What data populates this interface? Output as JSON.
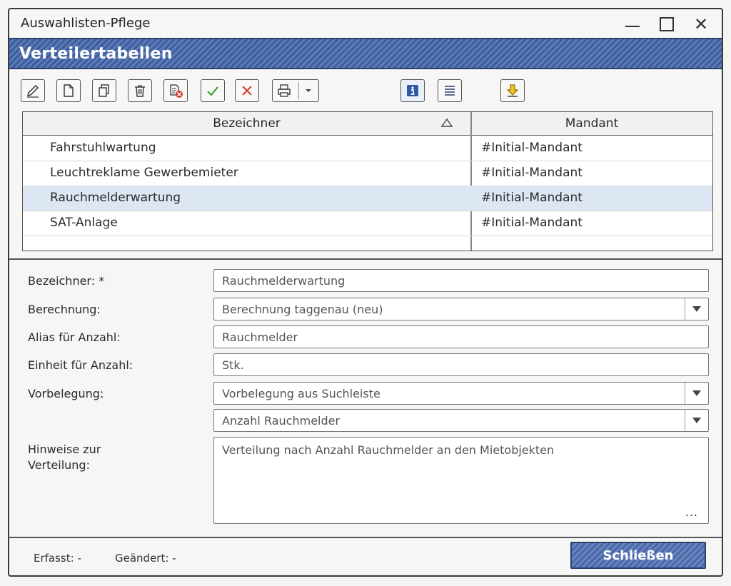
{
  "window": {
    "app_title": "Auswahlisten-Pflege"
  },
  "header": {
    "title": "Verteilertabellen"
  },
  "toolbar": {
    "buttons": [
      "edit-icon",
      "new-document-icon",
      "copy-icon",
      "trash-icon",
      "delete-document-icon",
      "check-icon",
      "cancel-icon",
      "print-icon",
      "info-icon",
      "list-icon",
      "download-icon"
    ],
    "check_color": "#3aa53a",
    "cancel_color": "#d23a2a"
  },
  "grid": {
    "columns": [
      "Bezeichner",
      "Mandant"
    ],
    "rows": [
      {
        "bezeichner": "Fahrstuhlwartung",
        "mandant": "#Initial-Mandant"
      },
      {
        "bezeichner": "Leuchtreklame Gewerbemieter",
        "mandant": "#Initial-Mandant"
      },
      {
        "bezeichner": "Rauchmelderwartung",
        "mandant": "#Initial-Mandant",
        "selected": true
      },
      {
        "bezeichner": "SAT-Anlage",
        "mandant": "#Initial-Mandant"
      }
    ]
  },
  "form": {
    "bezeichner": {
      "label": "Bezeichner: *",
      "value": "Rauchmelderwartung"
    },
    "berechnung": {
      "label": "Berechnung:",
      "value": "Berechnung taggenau (neu)"
    },
    "alias": {
      "label": "Alias für Anzahl:",
      "value": "Rauchmelder"
    },
    "einheit": {
      "label": "Einheit für Anzahl:",
      "value": "Stk."
    },
    "vorbelegung": {
      "label": "Vorbelegung:",
      "value": "Vorbelegung aus Suchleiste",
      "value2": "Anzahl Rauchmelder"
    },
    "hinweise": {
      "label1": "Hinweise zur",
      "label2": "Verteilung:",
      "value": "Verteilung nach Anzahl Rauchmelder an den Mietobjekten",
      "more": "..."
    }
  },
  "footer": {
    "erfasst": "Erfasst: -",
    "geaendert": "Geändert: -",
    "close_label": "Schließen"
  },
  "colors": {
    "accent": "#3d5d9c",
    "selection": "#dde6f3"
  }
}
